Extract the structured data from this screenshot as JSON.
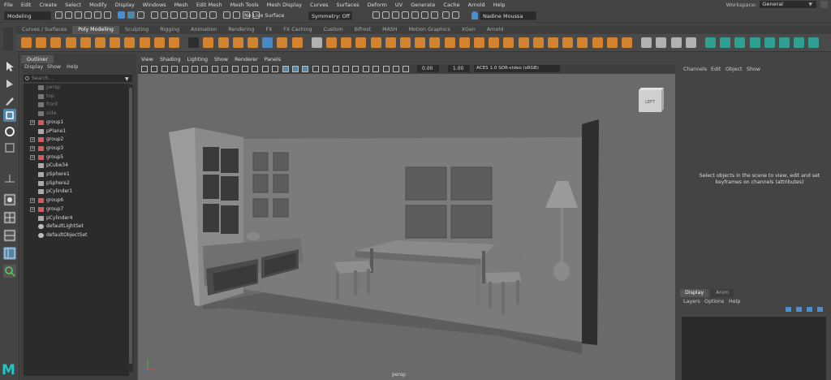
{
  "menu": [
    "File",
    "Edit",
    "Create",
    "Select",
    "Modify",
    "Display",
    "Windows",
    "Mesh",
    "Edit Mesh",
    "Mesh Tools",
    "Mesh Display",
    "Curves",
    "Surfaces",
    "Deform",
    "UV",
    "Generate",
    "Cache",
    "Arnold",
    "Help"
  ],
  "workspace": {
    "label": "Workspace:",
    "value": "General"
  },
  "statusline": {
    "mode": "Modeling",
    "live_surface": "No Live Surface",
    "symmetry": "Symmetry: Off",
    "user": "Nadine Moussa"
  },
  "shelf_tabs": [
    "Curves / Surfaces",
    "Poly Modeling",
    "Sculpting",
    "Rigging",
    "Animation",
    "Rendering",
    "FX",
    "FX Caching",
    "Custom",
    "Bifrost",
    "MASH",
    "Motion Graphics",
    "XGen",
    "Arnold"
  ],
  "shelf_active_tab": "Poly Modeling",
  "outliner": {
    "title": "Outliner",
    "menu": [
      "Display",
      "Show",
      "Help"
    ],
    "search_placeholder": "Search...",
    "items": [
      {
        "name": "persp",
        "type": "camera",
        "dim": true,
        "expand": false
      },
      {
        "name": "top",
        "type": "camera",
        "dim": true,
        "expand": false
      },
      {
        "name": "front",
        "type": "camera",
        "dim": true,
        "expand": false
      },
      {
        "name": "side",
        "type": "camera",
        "dim": true,
        "expand": false
      },
      {
        "name": "group1",
        "type": "group",
        "dim": false,
        "expand": true
      },
      {
        "name": "pPlane1",
        "type": "mesh",
        "dim": false,
        "expand": false
      },
      {
        "name": "group2",
        "type": "group",
        "dim": false,
        "expand": true
      },
      {
        "name": "group3",
        "type": "group",
        "dim": false,
        "expand": true
      },
      {
        "name": "group5",
        "type": "group",
        "dim": false,
        "expand": true
      },
      {
        "name": "pCube34",
        "type": "mesh",
        "dim": false,
        "expand": false
      },
      {
        "name": "pSphere1",
        "type": "mesh",
        "dim": false,
        "expand": false
      },
      {
        "name": "pSphere2",
        "type": "mesh",
        "dim": false,
        "expand": false
      },
      {
        "name": "pCylinder1",
        "type": "mesh",
        "dim": false,
        "expand": false
      },
      {
        "name": "group6",
        "type": "group",
        "dim": false,
        "expand": true
      },
      {
        "name": "group7",
        "type": "group",
        "dim": false,
        "expand": true
      },
      {
        "name": "pCylinder4",
        "type": "mesh",
        "dim": false,
        "expand": false
      },
      {
        "name": "defaultLightSet",
        "type": "set",
        "dim": false,
        "expand": false
      },
      {
        "name": "defaultObjectSet",
        "type": "set",
        "dim": false,
        "expand": false
      }
    ]
  },
  "viewport": {
    "menu": [
      "View",
      "Shading",
      "Lighting",
      "Show",
      "Renderer",
      "Panels"
    ],
    "gamma_left": "0.00",
    "gamma_right": "1.00",
    "color_space": "ACES 1.0 SDR-video (sRGB)",
    "camera_label": "persp",
    "viewcube_label": "LEFT"
  },
  "channelbox": {
    "menu": [
      "Channels",
      "Edit",
      "Object",
      "Show"
    ],
    "message_line1": "Select objects in the scene to view, edit and set",
    "message_line2": "keyframes on channels (attributes)"
  },
  "layers": {
    "tabs": [
      "Display",
      "Anim"
    ],
    "menu": [
      "Layers",
      "Options",
      "Help"
    ]
  },
  "colors": {
    "accent": "#e08a2e",
    "icon_teal": "#2ea89a",
    "icon_blue": "#4a8fd0",
    "selected": "#5285a6"
  }
}
